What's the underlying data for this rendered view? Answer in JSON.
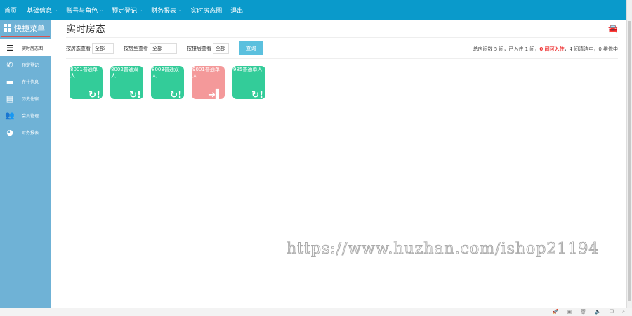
{
  "nav": [
    {
      "label": "首页"
    },
    {
      "label": "基础信息",
      "dropdown": true
    },
    {
      "label": "账号与角色",
      "dropdown": true
    },
    {
      "label": "预定登记",
      "dropdown": true
    },
    {
      "label": "财务报表",
      "dropdown": true
    },
    {
      "label": "实时房态图"
    },
    {
      "label": "退出"
    }
  ],
  "sidebar": {
    "title": "快捷菜单",
    "items": [
      {
        "label": "实时房态图",
        "icon": "list-icon"
      },
      {
        "label": "预定登记",
        "icon": "phone-icon"
      },
      {
        "label": "在住信息",
        "icon": "bed-icon"
      },
      {
        "label": "历史住宿",
        "icon": "document-icon"
      },
      {
        "label": "会员管理",
        "icon": "users-icon"
      },
      {
        "label": "财务报表",
        "icon": "pie-chart-icon"
      }
    ]
  },
  "page": {
    "title": "实时房态"
  },
  "filters": {
    "status_label": "按房态查看",
    "status_value": "全部",
    "type_label": "按房型查看",
    "type_value": "全部",
    "floor_label": "按楼层查看",
    "floor_value": "全部",
    "query_label": "查询"
  },
  "stats": {
    "total": "总房间数 5 间，",
    "occupied": "已入住 1 间，",
    "available": "0 间可入住",
    "cleaning": "，4 间清洁中，",
    "repair": "0 维修中"
  },
  "rooms": [
    {
      "name": "8001普通单人",
      "status": "cleaning"
    },
    {
      "name": "8002普通双人",
      "status": "cleaning"
    },
    {
      "name": "8003普通双人",
      "status": "cleaning"
    },
    {
      "name": "9001普通单人",
      "status": "occupied"
    },
    {
      "name": "985普通单人",
      "status": "cleaning"
    }
  ],
  "watermark": "https://www.huzhan.com/ishop21194",
  "colors": {
    "nav": "#0a9acb",
    "sidebar": "#6fb2d6",
    "room_clean": "#33cc99",
    "room_occupied": "#f4999a"
  }
}
